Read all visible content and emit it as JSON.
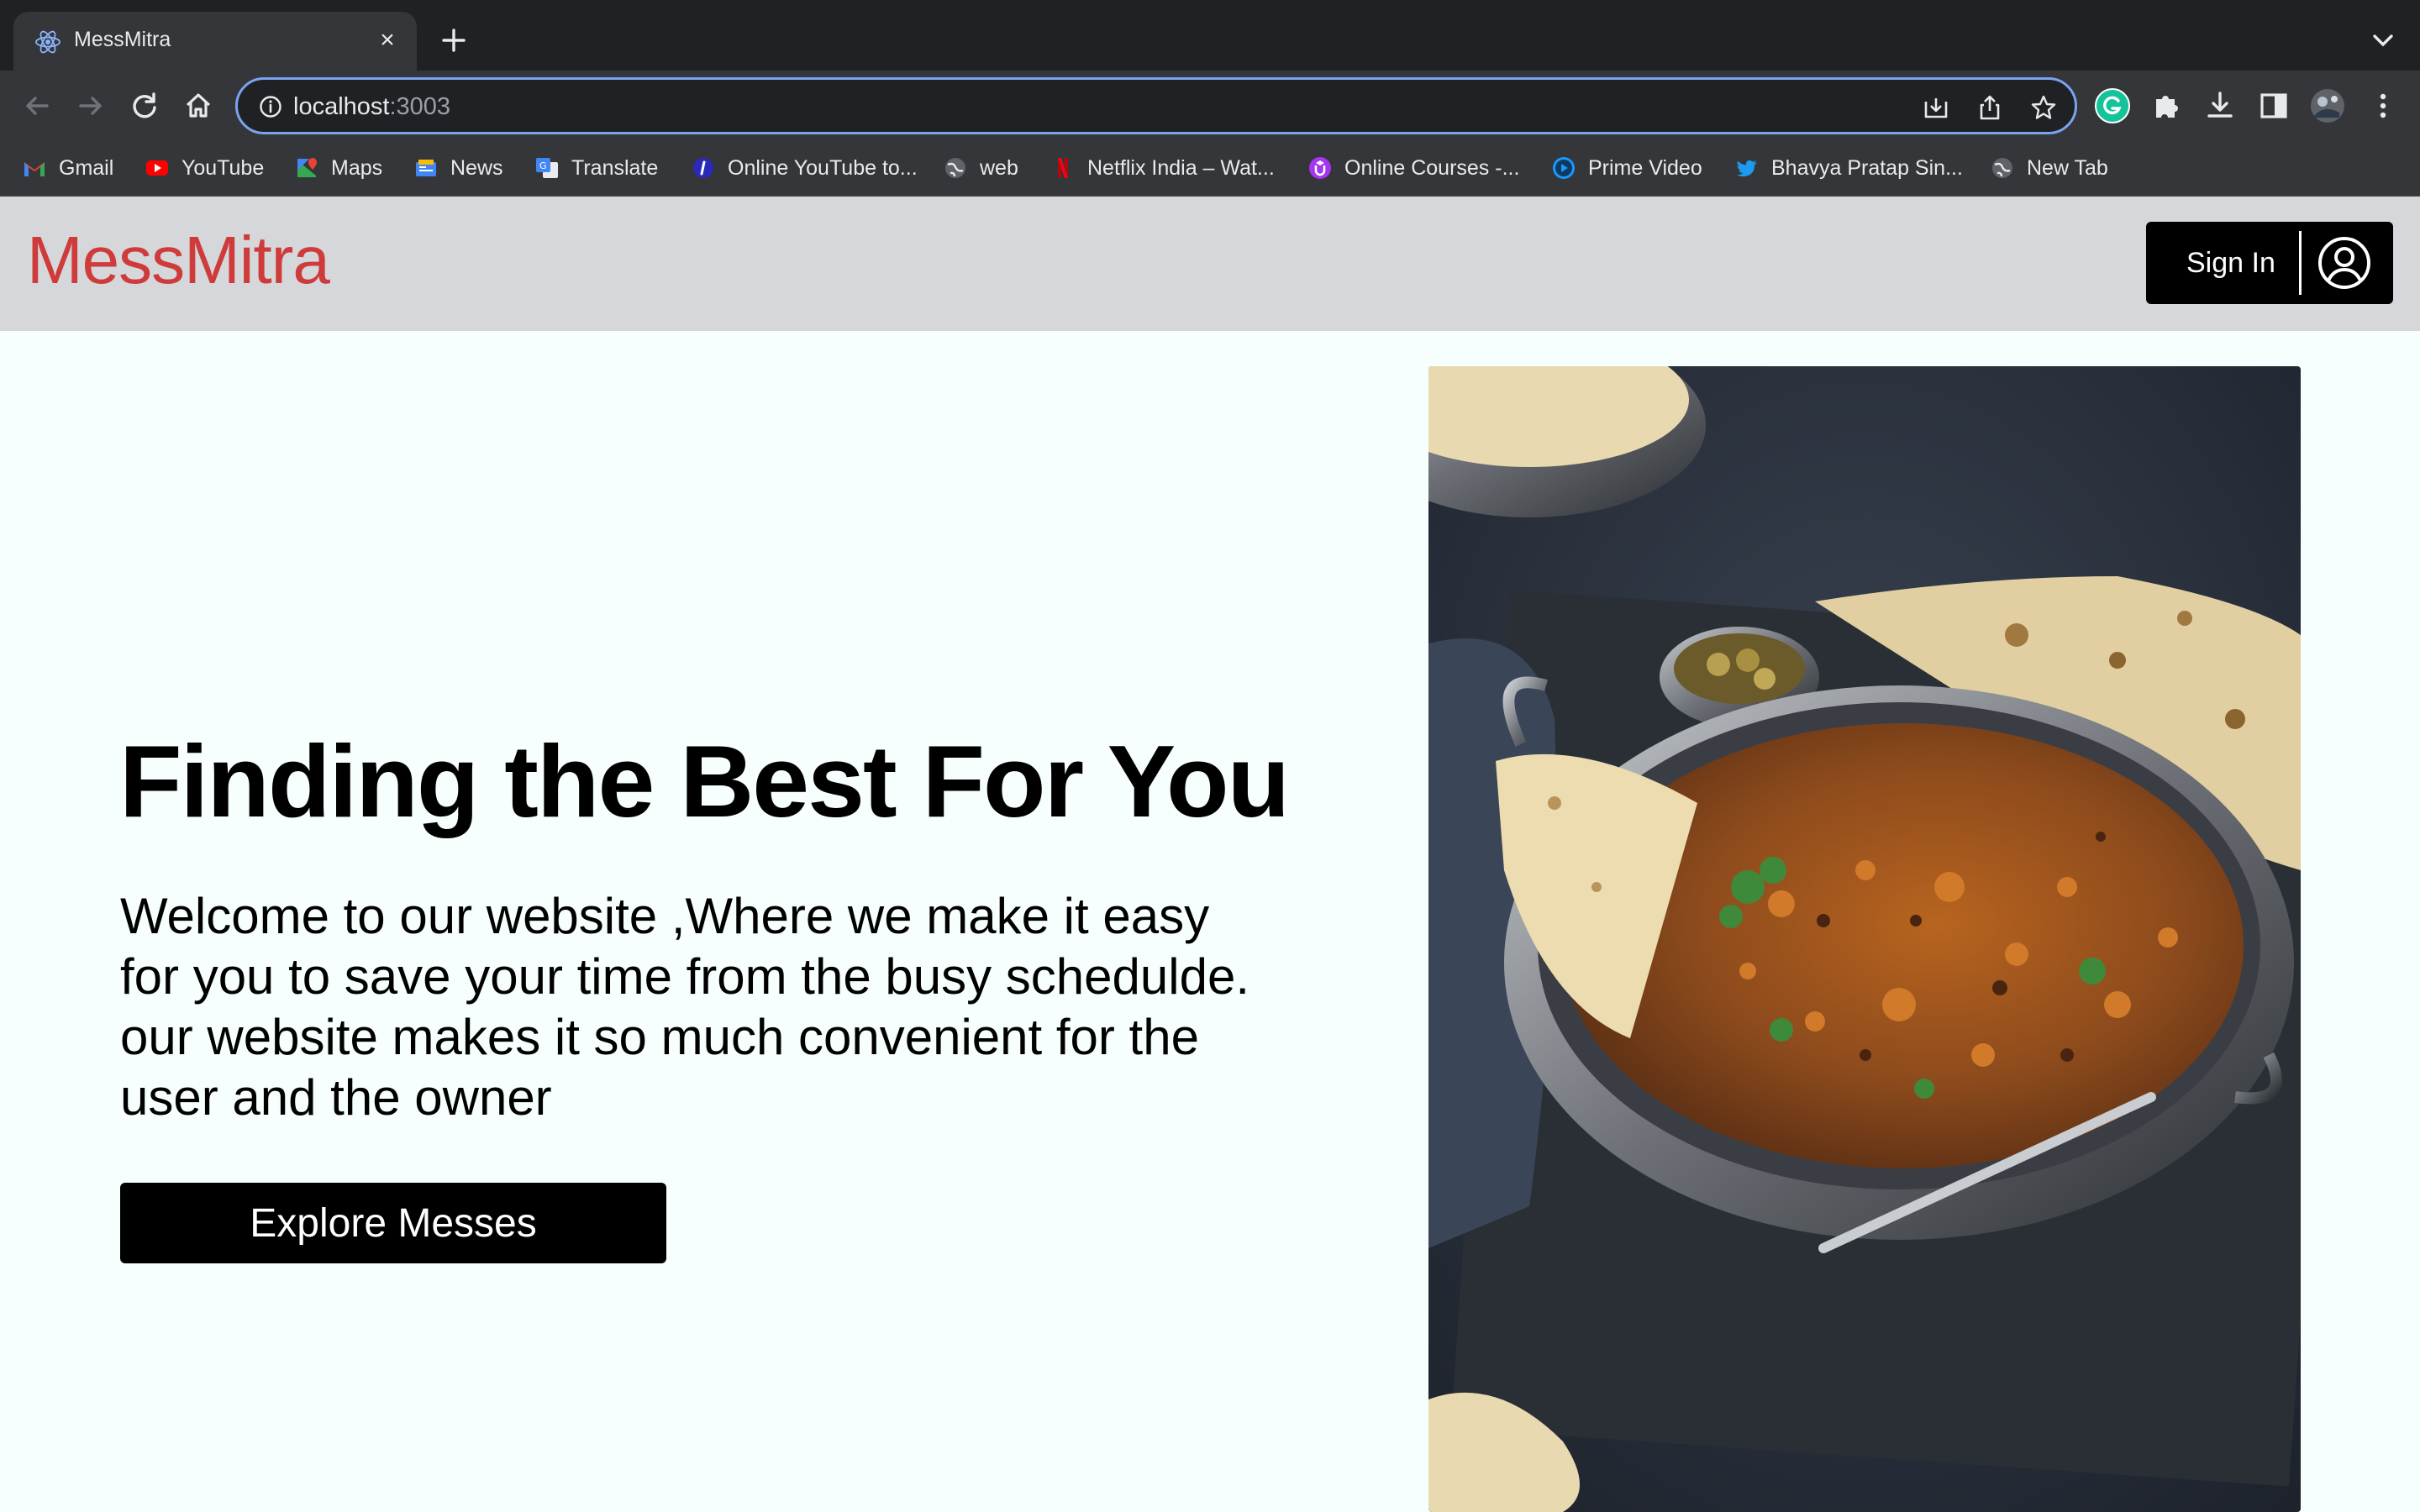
{
  "browser": {
    "tab": {
      "title": "MessMitra",
      "favicon": "react-icon"
    },
    "address": {
      "host": "localhost",
      "port": ":3003"
    },
    "bookmarks": [
      {
        "label": "Gmail",
        "icon": "gmail-icon",
        "color": "#ea4335"
      },
      {
        "label": "YouTube",
        "icon": "youtube-icon",
        "color": "#ff0000"
      },
      {
        "label": "Maps",
        "icon": "maps-icon",
        "color": "#34a853"
      },
      {
        "label": "News",
        "icon": "news-icon",
        "color": "#4285f4"
      },
      {
        "label": "Translate",
        "icon": "translate-icon",
        "color": "#4285f4"
      },
      {
        "label": "Online YouTube to...",
        "icon": "converter-icon",
        "color": "#2a2ab8"
      },
      {
        "label": "web",
        "icon": "globe-icon",
        "color": "#9aa0a6"
      },
      {
        "label": "Netflix India – Wat...",
        "icon": "netflix-icon",
        "color": "#e50914"
      },
      {
        "label": "Online Courses -...",
        "icon": "udemy-icon",
        "color": "#a435f0"
      },
      {
        "label": "Prime Video",
        "icon": "prime-video-icon",
        "color": "#1a98ff"
      },
      {
        "label": "Bhavya Pratap Sin...",
        "icon": "twitter-icon",
        "color": "#1d9bf0"
      },
      {
        "label": "New Tab",
        "icon": "globe-icon",
        "color": "#9aa0a6"
      }
    ]
  },
  "site": {
    "brand": "MessMitra",
    "brand_color": "#cf3b3b",
    "signin_label": "Sign In",
    "hero": {
      "title": "Finding the Best For You",
      "text": "Welcome to our website ,Where we make it easy for you to save your time from the busy schedulde. our website makes it so much convenient for the user and the owner",
      "cta": "Explore Messes",
      "image": "food-photo-biryani"
    }
  }
}
